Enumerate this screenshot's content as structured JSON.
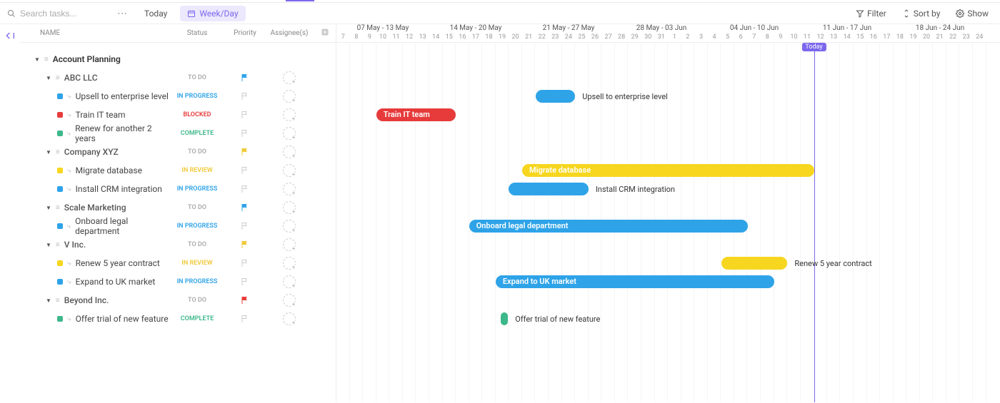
{
  "toolbar": {
    "searchPlaceholder": "Search tasks...",
    "today": "Today",
    "weekDay": "Week/Day",
    "filter": "Filter",
    "sortBy": "Sort by",
    "show": "Show",
    "todayBadge": "Today"
  },
  "columns": {
    "name": "NAME",
    "status": "Status",
    "priority": "Priority",
    "assignees": "Assignee(s)"
  },
  "statusLabels": {
    "TODO": "TO DO",
    "INPROGRESS": "IN PROGRESS",
    "BLOCKED": "BLOCKED",
    "COMPLETE": "COMPLETE",
    "INREVIEW": "IN REVIEW"
  },
  "folder": {
    "name": "Account Planning"
  },
  "weeks": [
    {
      "label": "07 May - 13 May",
      "days": [
        7,
        8,
        9,
        10,
        11,
        12,
        13
      ]
    },
    {
      "label": "14 May - 20 May",
      "days": [
        14,
        15,
        16,
        17,
        18,
        19,
        20
      ]
    },
    {
      "label": "21 May - 27 May",
      "days": [
        21,
        22,
        23,
        24,
        25,
        26,
        27
      ]
    },
    {
      "label": "28 May - 03 Jun",
      "days": [
        28,
        29,
        30,
        31,
        1,
        2,
        3
      ]
    },
    {
      "label": "04 Jun - 10 Jun",
      "days": [
        4,
        5,
        6,
        7,
        8,
        9,
        10
      ]
    },
    {
      "label": "11 Jun - 17 Jun",
      "days": [
        11,
        12,
        13,
        14,
        15,
        16,
        17
      ]
    },
    {
      "label": "18 Jun - 24 Jun",
      "days": [
        18,
        19,
        20,
        21,
        22,
        23,
        24
      ]
    }
  ],
  "todayColIndex": 36,
  "groups": [
    {
      "name": "ABC LLC",
      "status": "TODO",
      "priorityColor": "#2ea3e8",
      "tasks": [
        {
          "name": "Upsell to enterprise level",
          "status": "INPROGRESS",
          "color": "#2ea3e8",
          "startCol": 15,
          "span": 3,
          "labelOut": true,
          "rowIndex": 2
        },
        {
          "name": "Train IT team",
          "status": "BLOCKED",
          "color": "#e73b3b",
          "startCol": 3,
          "span": 6,
          "labelOut": false,
          "rowIndex": 3
        },
        {
          "name": "Renew for another 2 years",
          "status": "COMPLETE",
          "color": "#3db88b",
          "startCol": null,
          "span": 0,
          "rowIndex": 4
        }
      ]
    },
    {
      "name": "Company XYZ",
      "status": "TODO",
      "priorityColor": "#f0c93a",
      "tasks": [
        {
          "name": "Migrate database",
          "status": "INREVIEW",
          "color": "#f6d61f",
          "startCol": 14,
          "span": 22,
          "labelOut": false,
          "rowIndex": 6
        },
        {
          "name": "Install CRM integration",
          "status": "INPROGRESS",
          "color": "#2ea3e8",
          "startCol": 13,
          "span": 6,
          "labelOut": true,
          "rowIndex": 7
        }
      ]
    },
    {
      "name": "Scale Marketing",
      "status": "TODO",
      "priorityColor": "#2ea3e8",
      "tasks": [
        {
          "name": "Onboard legal department",
          "status": "INPROGRESS",
          "color": "#2ea3e8",
          "startCol": 10,
          "span": 21,
          "labelOut": false,
          "rowIndex": 9
        }
      ]
    },
    {
      "name": "V Inc.",
      "status": "TODO",
      "priorityColor": "#f0c93a",
      "tasks": [
        {
          "name": "Renew 5 year contract",
          "status": "INREVIEW",
          "color": "#f6d61f",
          "startCol": 29,
          "span": 5,
          "labelOut": true,
          "rowIndex": 11
        },
        {
          "name": "Expand to UK market",
          "status": "INPROGRESS",
          "color": "#2ea3e8",
          "startCol": 12,
          "span": 21,
          "labelOut": false,
          "rowIndex": 12
        }
      ]
    },
    {
      "name": "Beyond Inc.",
      "status": "TODO",
      "priorityColor": "#e73b3b",
      "tasks": [
        {
          "name": "Offer trial of new feature",
          "status": "COMPLETE",
          "color": "#3db88b",
          "startCol": 12.4,
          "span": 0.5,
          "labelOut": true,
          "rowIndex": 14
        }
      ]
    }
  ]
}
